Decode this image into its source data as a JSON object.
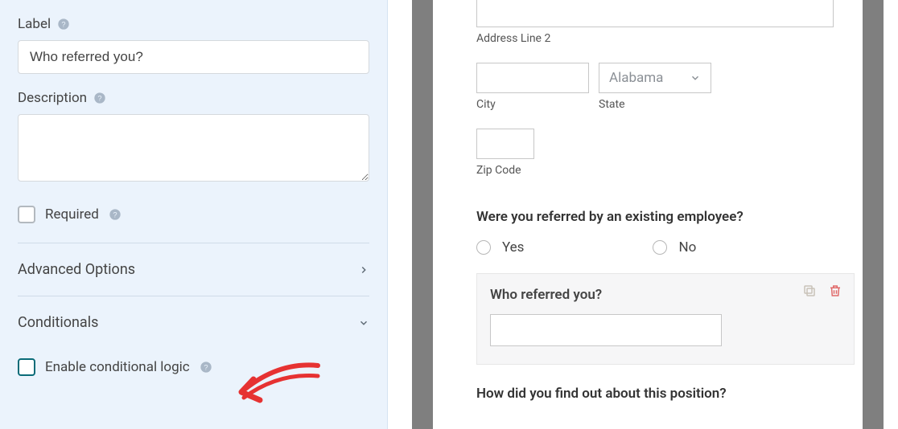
{
  "sidebar": {
    "label_title": "Label",
    "label_value": "Who referred you?",
    "description_title": "Description",
    "description_value": "",
    "required_label": "Required",
    "advanced_options_label": "Advanced Options",
    "conditionals_label": "Conditionals",
    "enable_conditional_label": "Enable conditional logic"
  },
  "preview": {
    "address2_label": "Address Line 2",
    "city_label": "City",
    "state_label": "State",
    "state_value": "Alabama",
    "zip_label": "Zip Code",
    "referred_question": "Were you referred by an existing employee?",
    "yes_label": "Yes",
    "no_label": "No",
    "who_referred_title": "Who referred you?",
    "how_find_question": "How did you find out about this position?"
  }
}
